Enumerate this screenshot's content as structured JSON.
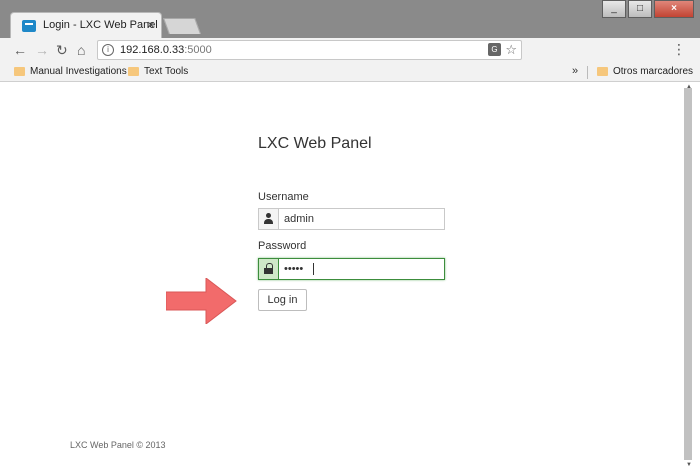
{
  "browser": {
    "tab": {
      "title": "Login - LXC Web Panel",
      "close_label": "×"
    },
    "window_controls": {
      "minimize": "_",
      "maximize": "□",
      "close": "×"
    },
    "address_bar": {
      "host": "192.168.0.33",
      "port": ":5000"
    },
    "bookmarks": [
      {
        "label": "Manual Investigations",
        "icon": "folder-icon"
      },
      {
        "label": "Text Tools",
        "icon": "folder-icon"
      }
    ],
    "bookmarks_overflow": "»",
    "other_bookmarks": "Otros marcadores"
  },
  "page": {
    "title": "LXC Web Panel",
    "username": {
      "label": "Username",
      "value": "admin",
      "icon": "user-icon"
    },
    "password": {
      "label": "Password",
      "value": "•••••",
      "icon": "lock-icon"
    },
    "login_button": "Log in",
    "footer": "LXC Web Panel © 2013"
  },
  "colors": {
    "arrow": "#f26b6b",
    "focus_border": "#3c8d3c",
    "favicon": "#1e88c8",
    "folder": "#f6c77c"
  }
}
